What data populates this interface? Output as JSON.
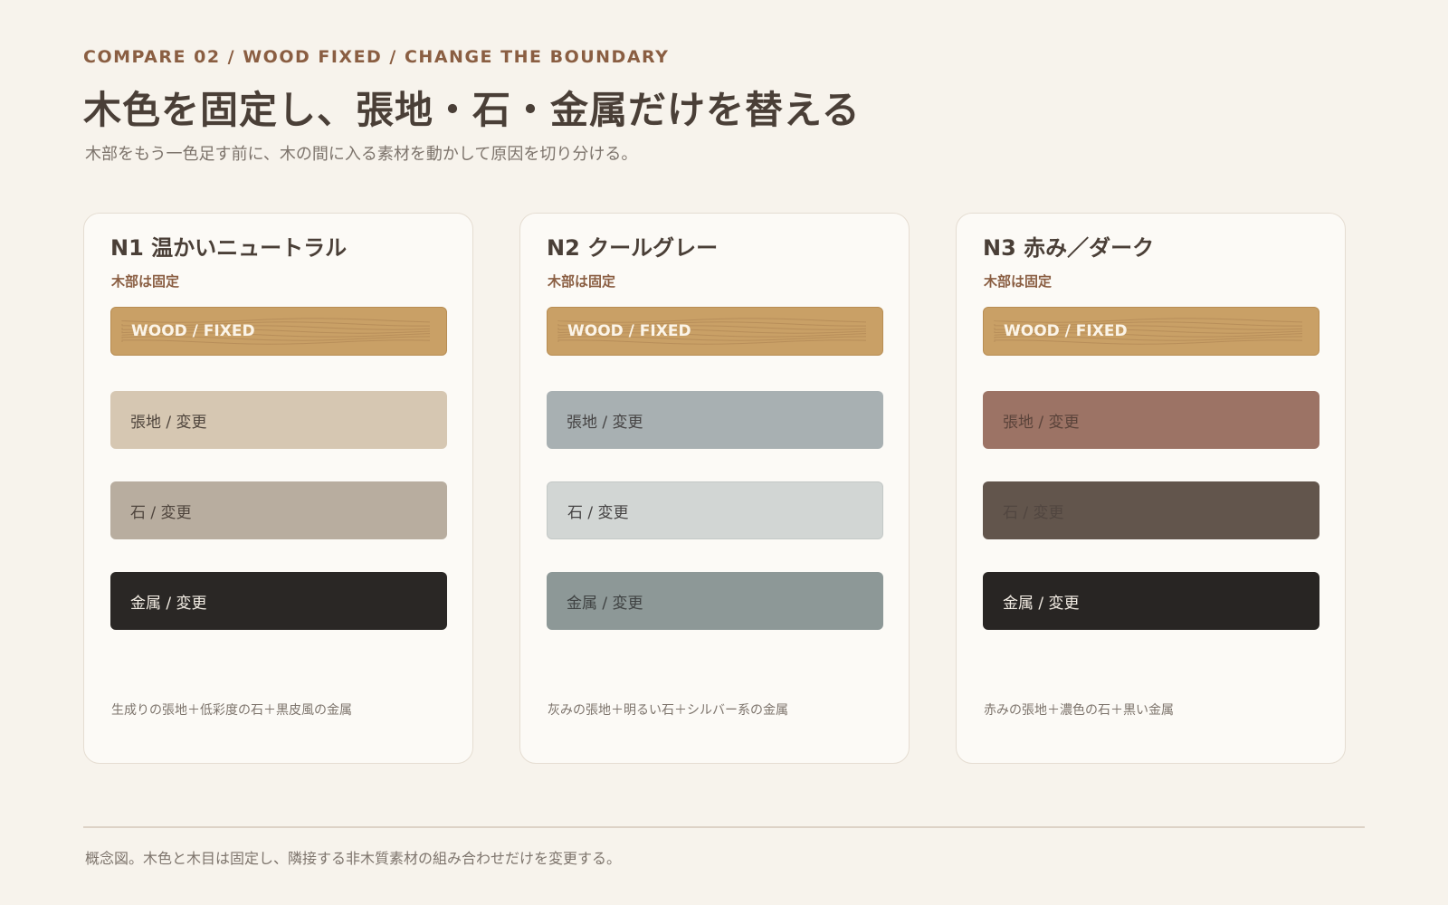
{
  "header": {
    "eyebrow": "COMPARE 02 / WOOD FIXED / CHANGE THE BOUNDARY",
    "title": "木色を固定し、張地・石・金属だけを替える",
    "subtitle": "木部をもう一色足す前に、木の間に入る素材を動かして原因を切り分ける。"
  },
  "cards": [
    {
      "title": "N1 温かいニュートラル",
      "note": "木部は固定",
      "wood_label": "WOOD / FIXED",
      "fabric_label": "張地 / 変更",
      "stone_label": "石 / 変更",
      "metal_label": "金属 / 変更",
      "caption": "生成りの張地＋低彩度の石＋黒皮風の金属",
      "colors": {
        "fabric": "#d6c7b2",
        "stone": "#b8ad9f",
        "metal": "#2a2725",
        "fabric_text": "#4f453d",
        "stone_text": "#4f453d",
        "metal_text": "#f3ede4"
      }
    },
    {
      "title": "N2 クールグレー",
      "note": "木部は固定",
      "wood_label": "WOOD / FIXED",
      "fabric_label": "張地 / 変更",
      "stone_label": "石 / 変更",
      "metal_label": "金属 / 変更",
      "caption": "灰みの張地＋明るい石＋シルバー系の金属",
      "colors": {
        "fabric": "#a8b0b2",
        "stone": "#d2d6d4",
        "metal": "#8d9897",
        "fabric_text": "#464444",
        "stone_text": "#464444",
        "metal_text": "#3f4242"
      }
    },
    {
      "title": "N3 赤み／ダーク",
      "note": "木部は固定",
      "wood_label": "WOOD / FIXED",
      "fabric_label": "張地 / 変更",
      "stone_label": "石 / 変更",
      "metal_label": "金属 / 変更",
      "caption": "赤みの張地＋濃色の石＋黒い金属",
      "colors": {
        "fabric": "#9c7365",
        "stone": "#62554c",
        "metal": "#282523",
        "fabric_text": "#5a433a",
        "stone_text": "#514640",
        "metal_text": "#f3ede4"
      }
    }
  ],
  "wood_color": "#c9a066",
  "footer": "概念図。木色と木目は固定し、隣接する非木質素材の組み合わせだけを変更する。"
}
